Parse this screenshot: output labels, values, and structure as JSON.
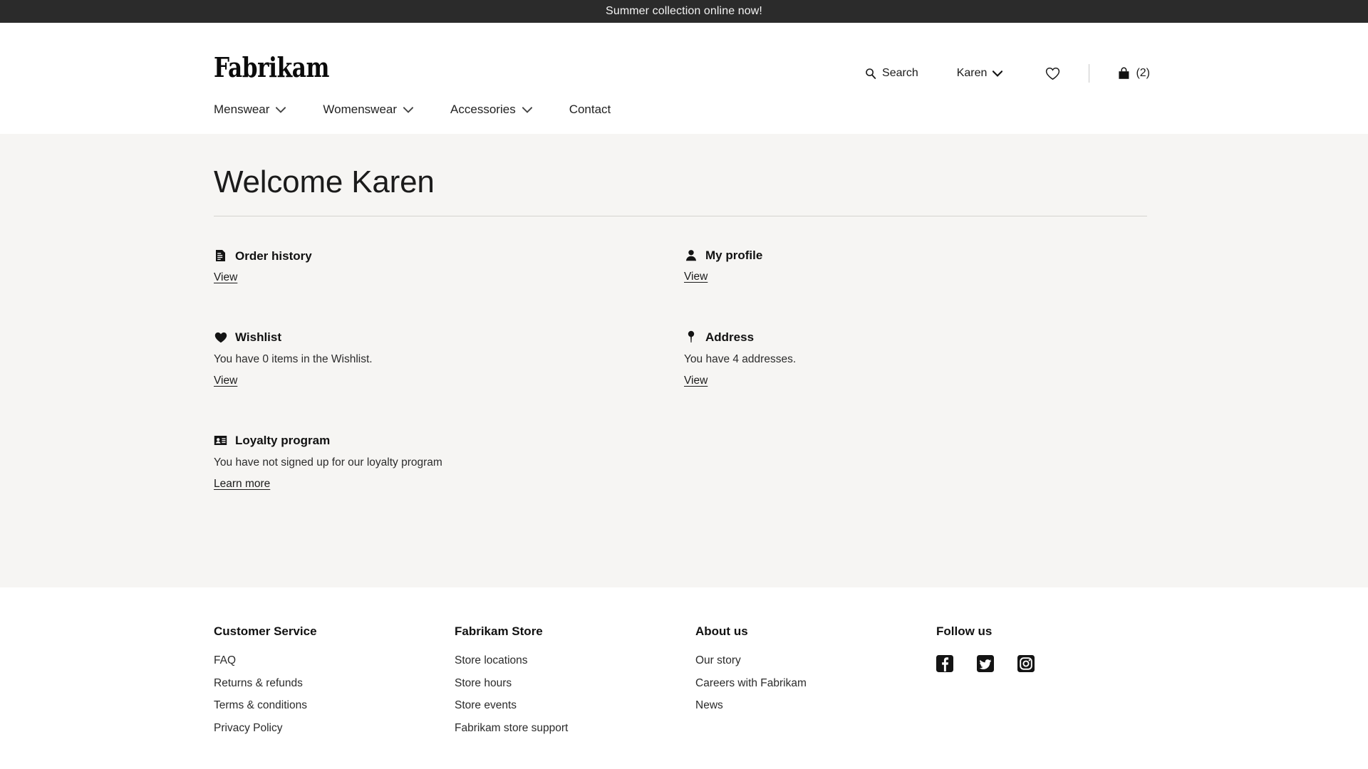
{
  "announcement": {
    "text": "Summer collection online now!"
  },
  "header": {
    "logo": "Fabrikam",
    "search_label": "Search",
    "account_label": "Karen",
    "cart_count": "(2)",
    "icons": {
      "search": "search-icon",
      "chevron": "chevron-down-icon",
      "wishlist": "heart-outline-icon",
      "cart": "shopping-bag-icon"
    }
  },
  "nav": {
    "items": [
      {
        "label": "Menswear",
        "has_caret": true
      },
      {
        "label": "Womenswear",
        "has_caret": true
      },
      {
        "label": "Accessories",
        "has_caret": true
      },
      {
        "label": "Contact",
        "has_caret": false
      }
    ]
  },
  "main": {
    "heading": "Welcome Karen",
    "left_cards": [
      {
        "icon": "document-icon",
        "title": "Order history",
        "description": "",
        "link": "View"
      },
      {
        "icon": "heart-filled-icon",
        "title": "Wishlist",
        "description": "You have 0 items in the Wishlist.",
        "link": "View"
      },
      {
        "icon": "id-card-icon",
        "title": "Loyalty program",
        "description": "You have not signed up for our loyalty program",
        "link": "Learn more"
      }
    ],
    "right_cards": [
      {
        "icon": "person-icon",
        "title": "My profile",
        "description": "",
        "link": "View"
      },
      {
        "icon": "map-pin-icon",
        "title": "Address",
        "description": "You have 4 addresses.",
        "link": "View"
      }
    ]
  },
  "footer": {
    "columns": [
      {
        "title": "Customer Service",
        "links": [
          "FAQ",
          "Returns & refunds",
          "Terms & conditions",
          "Privacy Policy"
        ]
      },
      {
        "title": "Fabrikam Store",
        "links": [
          "Store locations",
          "Store hours",
          "Store events",
          "Fabrikam store support"
        ]
      },
      {
        "title": "About us",
        "links": [
          "Our story",
          "Careers with Fabrikam",
          "News"
        ]
      }
    ],
    "social": {
      "title": "Follow us",
      "items": [
        "facebook-icon",
        "twitter-icon",
        "instagram-icon"
      ]
    }
  },
  "colors": {
    "announce_bg": "#2b2b2b",
    "page_bg": "#ffffff",
    "main_bg": "#f6f5f3",
    "text": "#1b1b1b",
    "rule": "#d4d2cf"
  }
}
